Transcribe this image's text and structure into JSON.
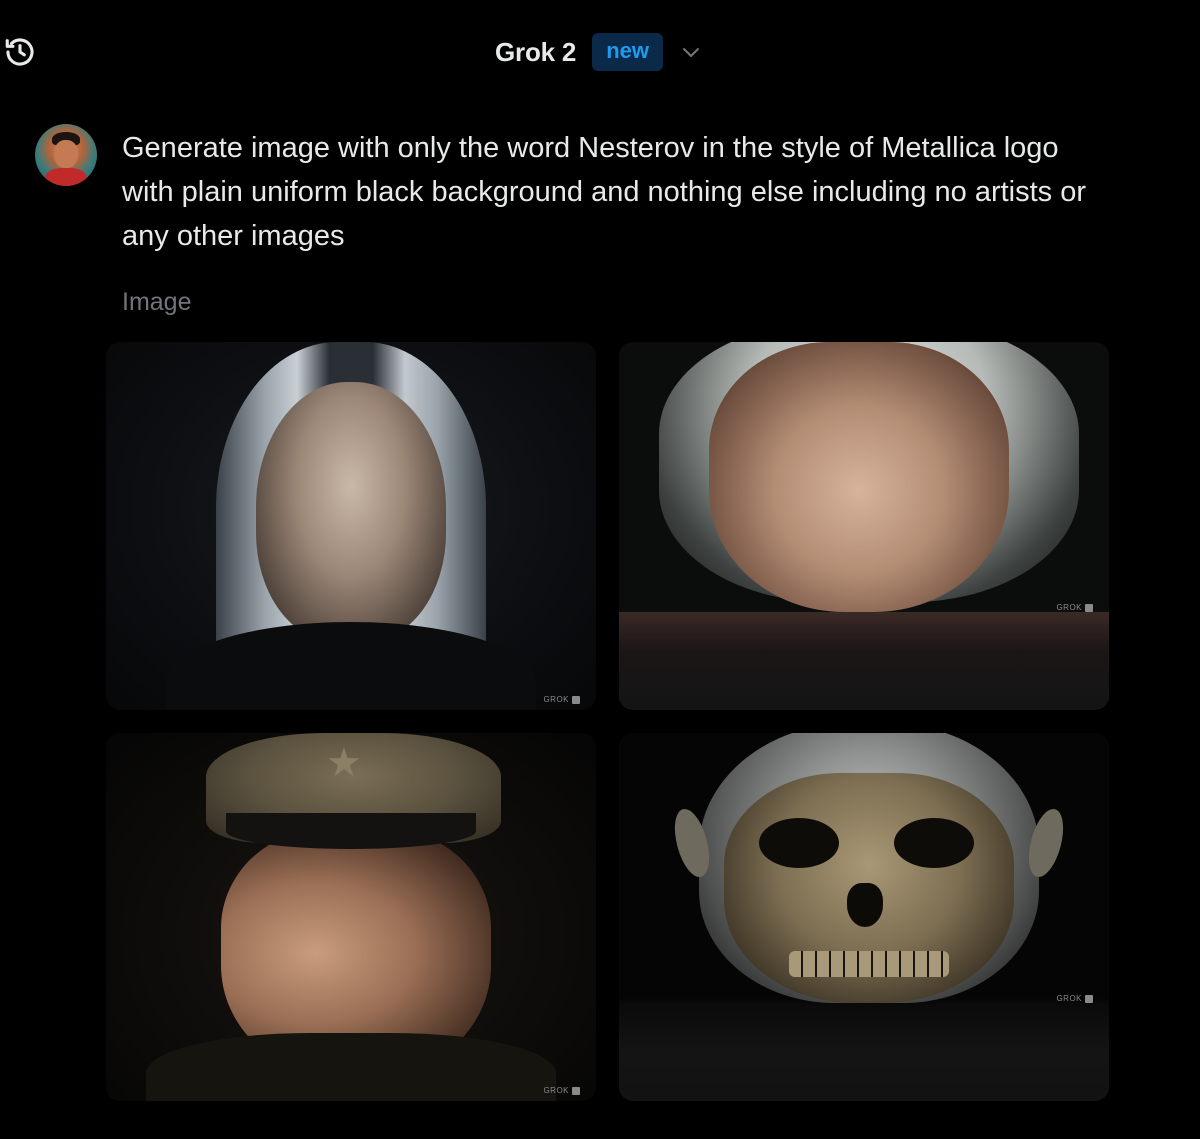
{
  "header": {
    "model_name": "Grok 2",
    "badge": "new",
    "history_icon": "history-clock-icon",
    "dropdown_icon": "chevron-down-icon"
  },
  "message": {
    "prompt": "Generate image with only the word Nesterov in the style of Metallica logo with plain uniform black background and nothing else including no artists or any other images"
  },
  "response": {
    "section_label": "Image",
    "images": [
      {
        "watermark": "GROK"
      },
      {
        "watermark": "GROK"
      },
      {
        "watermark": "GROK"
      },
      {
        "watermark": "GROK"
      }
    ]
  },
  "colors": {
    "background": "#000000",
    "text": "#e7e9ea",
    "muted": "#71767b",
    "accent": "#1d9bf0",
    "badge_bg": "#0b2a4a"
  }
}
